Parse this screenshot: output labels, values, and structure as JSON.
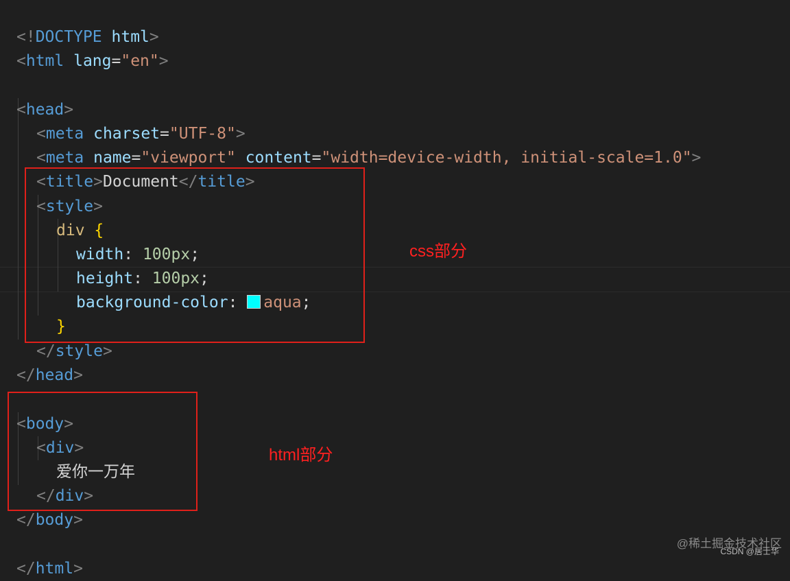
{
  "code": {
    "l1": {
      "p1": "<!",
      "kw": "DOCTYPE",
      "sp": " ",
      "tag": "html",
      "p2": ">"
    },
    "l2": {
      "p1": "<",
      "tag": "html",
      "sp": " ",
      "attr": "lang",
      "eq": "=",
      "str": "\"en\"",
      "p2": ">"
    },
    "l4": {
      "p1": "<",
      "tag": "head",
      "p2": ">"
    },
    "l5": {
      "p1": "<",
      "tag": "meta",
      "sp": " ",
      "attr": "charset",
      "eq": "=",
      "str": "\"UTF-8\"",
      "p2": ">"
    },
    "l6": {
      "p1": "<",
      "tag": "meta",
      "sp1": " ",
      "attr1": "name",
      "eq1": "=",
      "str1": "\"viewport\"",
      "sp2": " ",
      "attr2": "content",
      "eq2": "=",
      "str2": "\"width=device-width, initial-scale=1.0\"",
      "p2": ">"
    },
    "l7": {
      "p1": "<",
      "tag": "title",
      "p2": ">",
      "text": "Document",
      "p3": "</",
      "tag2": "title",
      "p4": ">"
    },
    "l8": {
      "p1": "<",
      "tag": "style",
      "p2": ">"
    },
    "l9": {
      "sel": "div",
      "sp": " ",
      "brace": "{"
    },
    "l10": {
      "prop": "width",
      "colon": ": ",
      "num": "100px",
      "semi": ";"
    },
    "l11": {
      "prop": "height",
      "colon": ": ",
      "num": "100px",
      "semi": ";"
    },
    "l12": {
      "prop": "background-color",
      "colon": ": ",
      "val": "aqua",
      "semi": ";",
      "swatch_color": "#00ffff"
    },
    "l13": {
      "brace": "}"
    },
    "l14": {
      "p1": "</",
      "tag": "style",
      "p2": ">"
    },
    "l15": {
      "p1": "</",
      "tag": "head",
      "p2": ">"
    },
    "l17": {
      "p1": "<",
      "tag": "body",
      "p2": ">"
    },
    "l18": {
      "p1": "<",
      "tag": "div",
      "p2": ">"
    },
    "l19": {
      "text": "爱你一万年"
    },
    "l20": {
      "p1": "</",
      "tag": "div",
      "p2": ">"
    },
    "l21": {
      "p1": "</",
      "tag": "body",
      "p2": ">"
    },
    "l23": {
      "p1": "</",
      "tag": "html",
      "p2": ">"
    }
  },
  "annotations": {
    "css_label": "css部分",
    "html_label": "html部分",
    "box_color": "#e0201a"
  },
  "watermark": {
    "main": "@稀土掘金技术社区",
    "sub": "CSDN @居士华"
  }
}
